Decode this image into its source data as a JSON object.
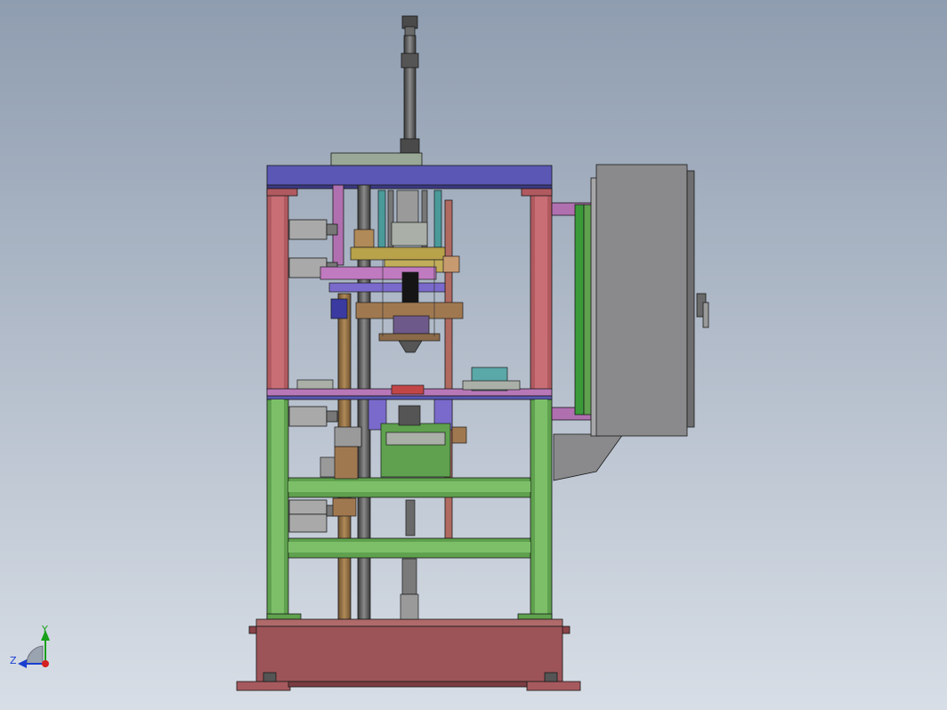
{
  "view": {
    "background_top": "#8f9db0",
    "background_bottom": "#d8dee6"
  },
  "triad": {
    "x_label": "",
    "y_label": "Y",
    "z_label": "Z",
    "x_color": "#d42020",
    "y_color": "#18a018",
    "z_color": "#1a3fd0"
  },
  "machine": {
    "frame_upper_color": "#b05a60",
    "frame_lower_color": "#5fa14e",
    "top_plate_color": "#5a58b4",
    "base_color": "#9c5458",
    "cabinet_color": "#8a8a8c",
    "column_color": "#6a6a6a"
  }
}
